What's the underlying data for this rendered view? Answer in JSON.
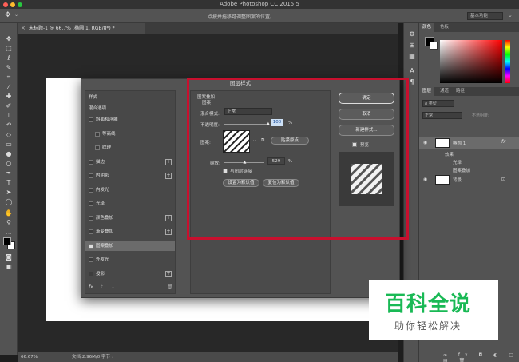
{
  "app": {
    "title": "Adobe Photoshop CC 2015.5"
  },
  "options_bar": {
    "hint": "点按并拖移可调整图案的位置。",
    "workspace": "基本功能"
  },
  "document_tab": {
    "label": "未标题-1 @ 66.7% (椭圆 1, RGB/8*) *",
    "close": "×"
  },
  "status_bar": {
    "zoom": "66.67%",
    "doc_info": "文档:2.96M/0 字节"
  },
  "right_panel": {
    "color_tabs": [
      "颜色",
      "色板"
    ],
    "layer_tabs": [
      "图层",
      "通道",
      "路径"
    ],
    "kind_filter": "ρ 类型",
    "blend_mode": "正常",
    "opacity_label": "不透明度:",
    "layers": [
      {
        "name": "椭圆 1",
        "fx": "fx"
      },
      {
        "name": "效果"
      },
      {
        "name": "光泽"
      },
      {
        "name": "图案叠加"
      },
      {
        "name": "背景"
      }
    ]
  },
  "dialog": {
    "title": "图层样式",
    "styles_header": "样式",
    "blend_options": "混合选项",
    "items": [
      {
        "label": "斜面和浮雕",
        "checked": false,
        "plus": false
      },
      {
        "label": "等高线",
        "checked": false,
        "plus": false,
        "indent": true
      },
      {
        "label": "纹理",
        "checked": false,
        "plus": false,
        "indent": true
      },
      {
        "label": "描边",
        "checked": false,
        "plus": true
      },
      {
        "label": "内阴影",
        "checked": false,
        "plus": true
      },
      {
        "label": "内发光",
        "checked": false,
        "plus": false
      },
      {
        "label": "光泽",
        "checked": false,
        "plus": false
      },
      {
        "label": "颜色叠加",
        "checked": false,
        "plus": true
      },
      {
        "label": "渐变叠加",
        "checked": false,
        "plus": true
      },
      {
        "label": "图案叠加",
        "checked": true,
        "plus": false,
        "selected": true
      },
      {
        "label": "外发光",
        "checked": false,
        "plus": false
      },
      {
        "label": "投影",
        "checked": false,
        "plus": true
      }
    ],
    "list_footer": {
      "fx": "fx",
      "up": "⇡",
      "down": "⇣",
      "trash": "🗑"
    },
    "section_title": "图案叠加",
    "group_title": "图案",
    "blend_mode_label": "混合模式:",
    "blend_mode_value": "正常",
    "opacity_label": "不透明度:",
    "opacity_value": "100",
    "opacity_unit": "%",
    "opacity_fraction": 1.0,
    "pattern_label": "图案:",
    "snap_button": "贴紧原点",
    "scale_label": "缩放:",
    "scale_value": "529",
    "scale_unit": "%",
    "scale_fraction": 0.53,
    "link_label": "与图层链接",
    "link_checked": true,
    "set_default": "设置为默认值",
    "reset_default": "复位为默认值",
    "ok": "确定",
    "cancel": "取消",
    "new_style": "新建样式...",
    "preview_label": "预览",
    "preview_checked": true
  },
  "watermark": {
    "line1": "百科全说",
    "line2": "助你轻松解决"
  },
  "colors": {
    "highlight_red": "#c8102e",
    "brand_green": "#19b955"
  }
}
